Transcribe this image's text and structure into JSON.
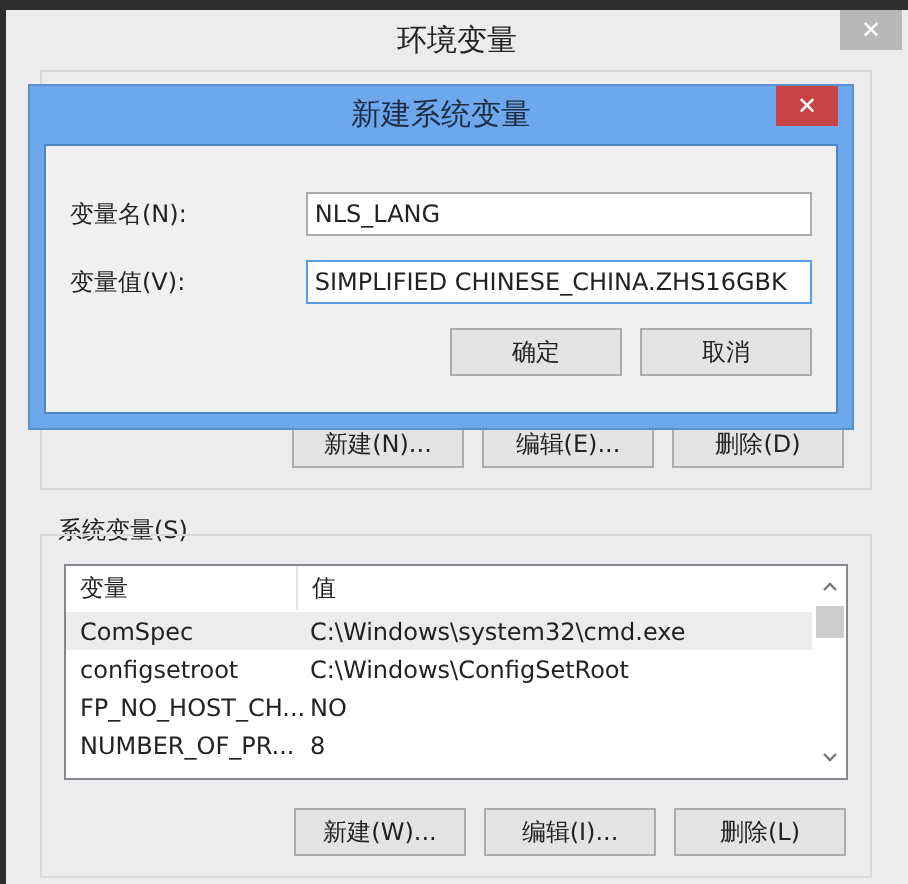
{
  "window": {
    "title": "环境变量",
    "close": "✕"
  },
  "user_variables": {
    "buttons": [
      "新建(N)...",
      "编辑(E)...",
      "删除(D)"
    ]
  },
  "system_variables": {
    "label": "系统变量(S)",
    "columns": [
      "变量",
      "值"
    ],
    "rows": [
      {
        "name": "ComSpec",
        "value": "C:\\Windows\\system32\\cmd.exe",
        "selected": true
      },
      {
        "name": "configsetroot",
        "value": "C:\\Windows\\ConfigSetRoot",
        "selected": false
      },
      {
        "name": "FP_NO_HOST_CH...",
        "value": "NO",
        "selected": false
      },
      {
        "name": "NUMBER_OF_PR...",
        "value": "8",
        "selected": false
      }
    ],
    "buttons": [
      "新建(W)...",
      "编辑(I)...",
      "删除(L)"
    ]
  },
  "dialog": {
    "title": "新建系统变量",
    "close": "✕",
    "fields": [
      {
        "label": "变量名(N):",
        "value": "NLS_LANG",
        "focused": false
      },
      {
        "label": "变量值(V):",
        "value": "SIMPLIFIED CHINESE_CHINA.ZHS16GBK",
        "focused": true
      }
    ],
    "buttons": [
      "确定",
      "取消"
    ]
  }
}
